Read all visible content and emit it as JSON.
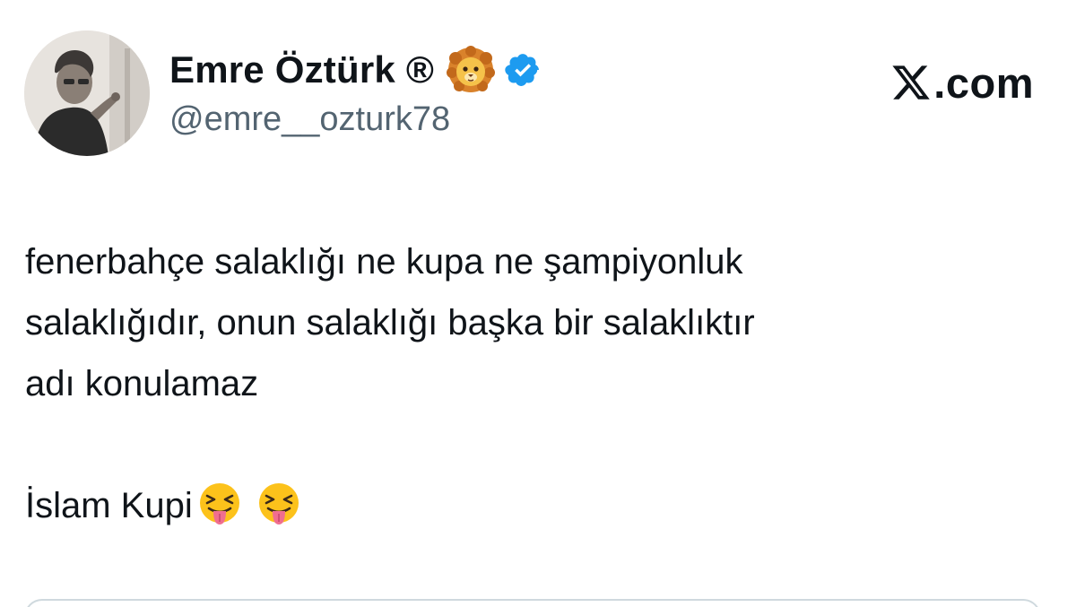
{
  "author": {
    "display_name": "Emre Öztürk ®",
    "handle": "@emre__ozturk78",
    "badges": [
      "lion-face-emoji",
      "verified-badge-icon"
    ],
    "avatar_icon": "profile-photo-avatar"
  },
  "brand": {
    "logo_icon": "x-logo-icon",
    "text": ".com"
  },
  "tweet": {
    "lines": [
      "fenerbahçe salaklığı ne kupa ne şampiyonluk",
      "salaklığıdır, onun salaklığı başka bir salaklıktır",
      "adı konulamaz"
    ],
    "signoff": "İslam Kupi",
    "signoff_emojis": [
      "squinting-face-with-tongue-emoji",
      "squinting-face-with-tongue-emoji"
    ]
  },
  "colors": {
    "text_primary": "#0f1419",
    "text_secondary": "#536471",
    "verified_blue": "#1d9bf0",
    "border": "#cfd9de"
  }
}
